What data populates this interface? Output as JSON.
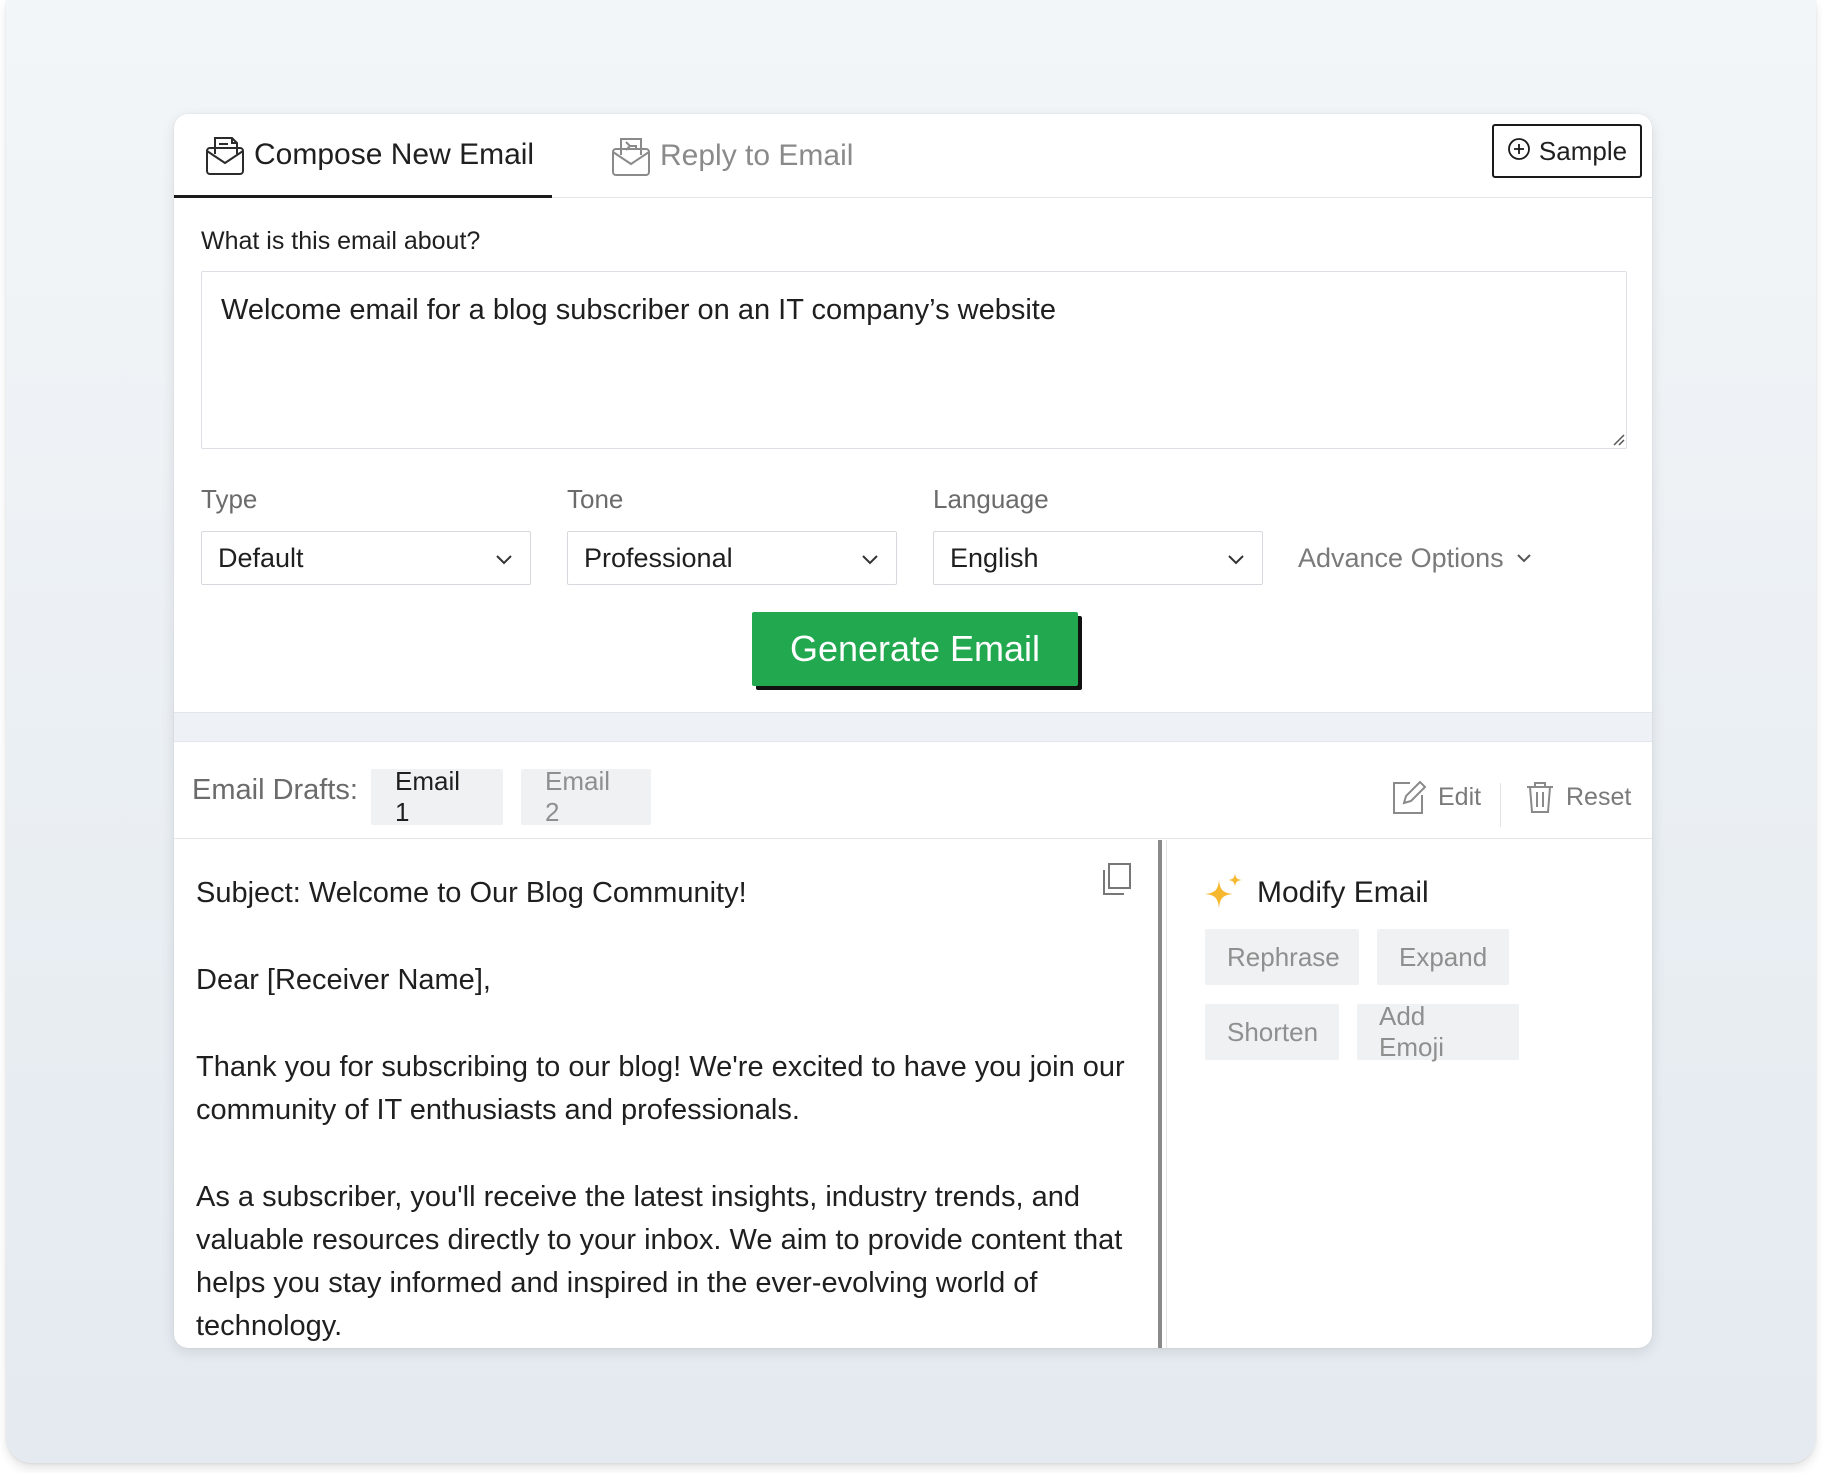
{
  "tabs": {
    "compose_label": "Compose New Email",
    "reply_label": "Reply to Email",
    "sample_label": "Sample"
  },
  "form": {
    "question": "What is this email about?",
    "prompt_value": "Welcome email for a blog subscriber on an IT company’s website",
    "type": {
      "label": "Type",
      "value": "Default"
    },
    "tone": {
      "label": "Tone",
      "value": "Professional"
    },
    "language": {
      "label": "Language",
      "value": "English"
    },
    "advance_options": "Advance Options",
    "generate_label": "Generate Email"
  },
  "drafts": {
    "label": "Email Drafts:",
    "tabs": [
      "Email 1",
      "Email 2"
    ],
    "active_index": 0,
    "edit_label": "Edit",
    "reset_label": "Reset"
  },
  "email": {
    "subject": "Subject: Welcome to Our Blog Community!",
    "greeting": "Dear [Receiver Name],",
    "paragraph_1": "Thank you for subscribing to our blog! We're excited to have you join our community of IT enthusiasts and professionals.",
    "paragraph_2": "As a subscriber, you'll receive the latest insights, industry trends, and valuable resources directly to your inbox. We aim to provide content that helps you stay informed and inspired in the ever-evolving world of technology."
  },
  "modify": {
    "title": "Modify Email",
    "actions": [
      "Rephrase",
      "Expand",
      "Shorten",
      "Add Emoji"
    ]
  },
  "colors": {
    "accent_green": "#22a84f",
    "spark_gold": "#f5b82e",
    "muted_text": "#7a7a7a"
  },
  "icons": [
    "compose-email-icon",
    "reply-email-icon",
    "plus-circle-icon",
    "chevron-down-icon",
    "edit-icon",
    "trash-icon",
    "copy-icon",
    "sparkle-icon"
  ]
}
